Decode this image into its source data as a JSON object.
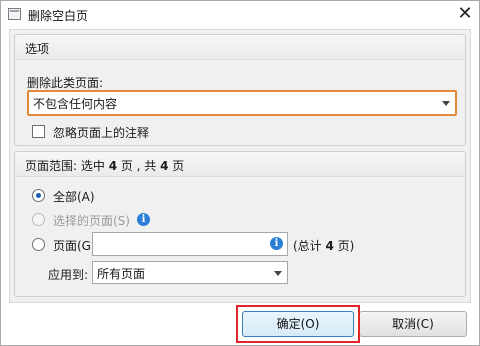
{
  "window": {
    "title": "删除空白页",
    "close_glyph": "✕"
  },
  "options_group": {
    "title": "选项",
    "delete_type_label": "删除此类页面:",
    "delete_type_value": "不包含任何内容",
    "ignore_annotations_label": "忽略页面上的注释",
    "ignore_annotations_checked": false
  },
  "page_range_group": {
    "title_prefix": "页面范围: 选中 ",
    "selected_count": "4",
    "title_mid": " 页 , 共 ",
    "total_count": "4",
    "title_suffix": " 页",
    "radio_all_label": "全部(A)",
    "radio_selected_label": "选择的页面(S)",
    "radio_pages_label": "页面(G)",
    "pages_input_value": "",
    "total_pages_prefix": "(总计 ",
    "total_pages_count": "4",
    "total_pages_suffix": " 页)",
    "apply_to_label": "应用到:",
    "apply_to_value": "所有页面",
    "selected_radio": "all"
  },
  "buttons": {
    "ok": "确定(O)",
    "cancel": "取消(C)"
  },
  "colors": {
    "focus_orange": "#e08a3a",
    "highlight_red": "#e0262a",
    "info_blue": "#2a7fd6"
  },
  "icons": {
    "info": "i",
    "dropdown": "chevron-down-icon"
  }
}
